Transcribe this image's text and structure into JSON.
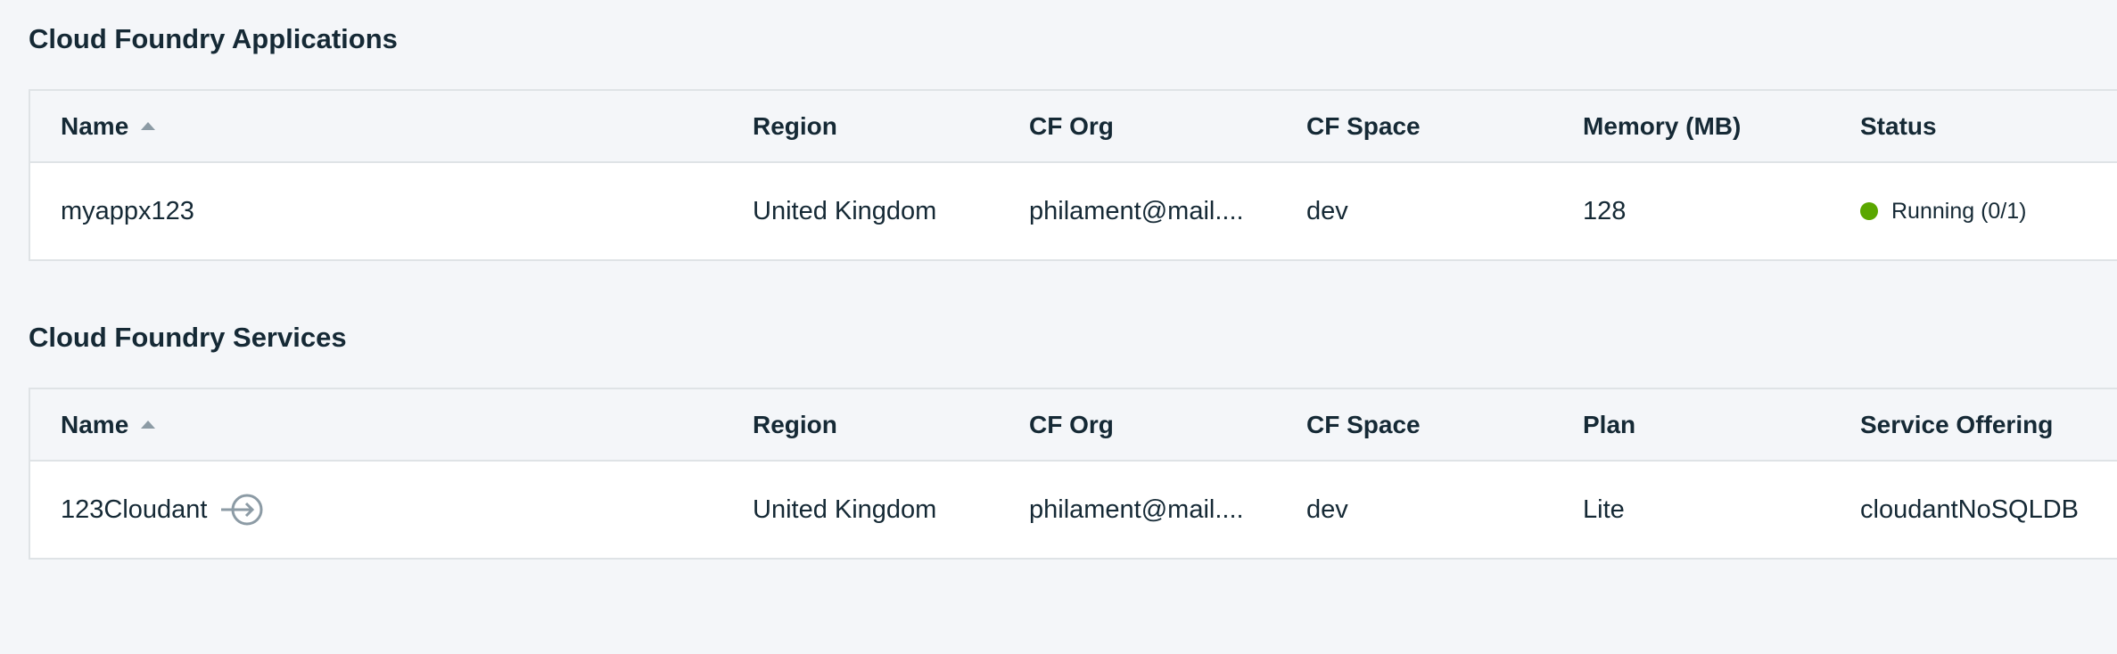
{
  "colors": {
    "page_bg": "#f4f6f9",
    "status_running": "#5aa700",
    "icon_gray": "#8c9ba5",
    "text": "#152935"
  },
  "applications": {
    "title": "Cloud Foundry Applications",
    "columns": [
      "Name",
      "Region",
      "CF Org",
      "CF Space",
      "Memory (MB)",
      "Status"
    ],
    "sort_icon": "sort-ascending-icon",
    "rows": [
      {
        "name": "myappx123",
        "region": "United Kingdom",
        "cf_org": "philament@mail....",
        "cf_space": "dev",
        "memory": "128",
        "status": "Running (0/1)",
        "status_icon": "status-dot-icon"
      }
    ]
  },
  "services": {
    "title": "Cloud Foundry Services",
    "columns": [
      "Name",
      "Region",
      "CF Org",
      "CF Space",
      "Plan",
      "Service Offering"
    ],
    "sort_icon": "sort-ascending-icon",
    "rows": [
      {
        "name": "123Cloudant",
        "name_icon": "bind-service-icon",
        "region": "United Kingdom",
        "cf_org": "philament@mail....",
        "cf_space": "dev",
        "plan": "Lite",
        "service_offering": "cloudantNoSQLDB"
      }
    ]
  }
}
